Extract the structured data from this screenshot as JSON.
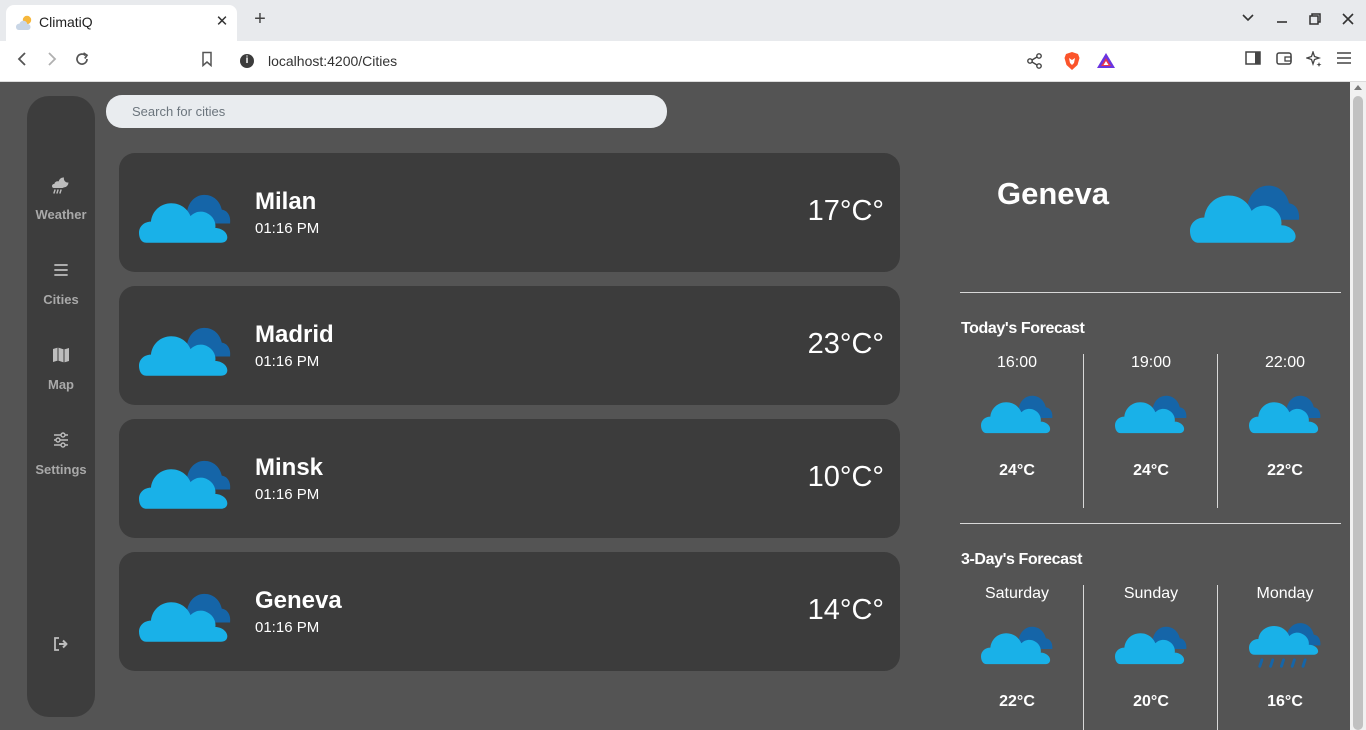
{
  "browser": {
    "tab_title": "ClimatiQ",
    "url": "localhost:4200/Cities"
  },
  "sidebar": {
    "items": [
      {
        "label": "Weather",
        "icon": "cloud-rain-icon"
      },
      {
        "label": "Cities",
        "icon": "list-icon"
      },
      {
        "label": "Map",
        "icon": "map-icon"
      },
      {
        "label": "Settings",
        "icon": "sliders-icon"
      }
    ],
    "logout_icon": "logout-icon"
  },
  "search": {
    "placeholder": "Search for cities"
  },
  "cities": [
    {
      "name": "Milan",
      "time": "01:16 PM",
      "temp": "17°C°"
    },
    {
      "name": "Madrid",
      "time": "01:16 PM",
      "temp": "23°C°"
    },
    {
      "name": "Minsk",
      "time": "01:16 PM",
      "temp": "10°C°"
    },
    {
      "name": "Geneva",
      "time": "01:16 PM",
      "temp": "14°C°"
    }
  ],
  "detail": {
    "city": "Geneva",
    "today_title": "Today's Forecast",
    "today": [
      {
        "label": "16:00",
        "temp": "24°C",
        "icon": "cloud-icon"
      },
      {
        "label": "19:00",
        "temp": "24°C",
        "icon": "cloud-icon"
      },
      {
        "label": "22:00",
        "temp": "22°C",
        "icon": "cloud-icon"
      }
    ],
    "threeday_title": "3-Day's Forecast",
    "threeday": [
      {
        "label": "Saturday",
        "temp": "22°C",
        "icon": "cloud-icon"
      },
      {
        "label": "Sunday",
        "temp": "20°C",
        "icon": "cloud-icon"
      },
      {
        "label": "Monday",
        "temp": "16°C",
        "icon": "cloud-rain-icon"
      }
    ]
  },
  "colors": {
    "cloud_front": "#19b1e8",
    "cloud_back": "#1565a8",
    "rain": "#1565a8",
    "card_bg": "#3c3c3c",
    "page_bg": "#545454"
  }
}
